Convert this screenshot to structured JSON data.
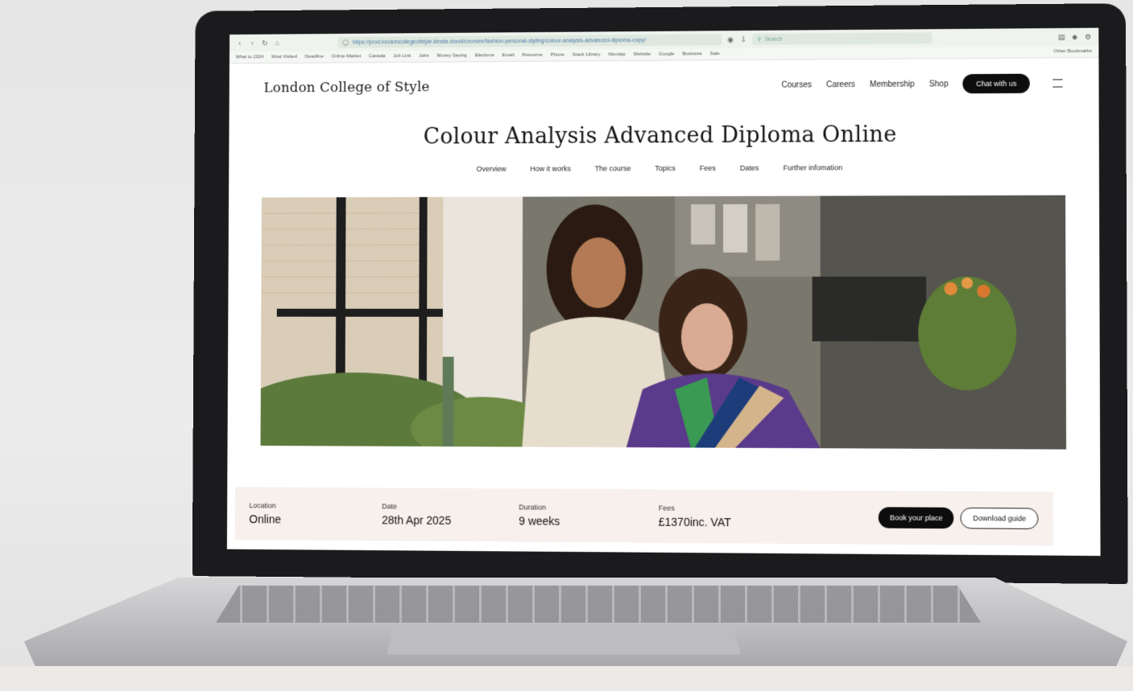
{
  "browser": {
    "url": "https://prod.londoncollegeofstyle.kinsta.cloud/courses/fashion-personal-styling/colour-analysis-advanced-diploma-copy/",
    "search_placeholder": "Search",
    "bookmarks": [
      "What to 2024",
      "Most Visited",
      "Deadline",
      "Online Market",
      "Canada",
      "Job Link",
      "Jobs",
      "Money Saving",
      "Elections",
      "Email",
      "Resource",
      "Phone",
      "Stack Library",
      "Monday",
      "Website",
      "Google",
      "Business",
      "Sale",
      "Other Bookmarks"
    ]
  },
  "header": {
    "logo": "London College of Style",
    "nav": [
      "Courses",
      "Careers",
      "Membership",
      "Shop"
    ],
    "chat_label": "Chat with us"
  },
  "page": {
    "title": "Colour Analysis Advanced Diploma Online",
    "subnav": [
      "Overview",
      "How it works",
      "The course",
      "Topics",
      "Fees",
      "Dates",
      "Further infomation"
    ]
  },
  "course_info": {
    "location_label": "Location",
    "location_value": "Online",
    "date_label": "Date",
    "date_value": "28th Apr 2025",
    "duration_label": "Duration",
    "duration_value": "9 weeks",
    "fees_label": "Fees",
    "fees_value": "£1370inc. VAT",
    "book_label": "Book your place",
    "guide_label": "Download guide"
  },
  "colors": {
    "accent_dark": "#0d0d0d",
    "info_strip_bg": "#f7f0ec",
    "bezel": "#1b1b1d"
  }
}
